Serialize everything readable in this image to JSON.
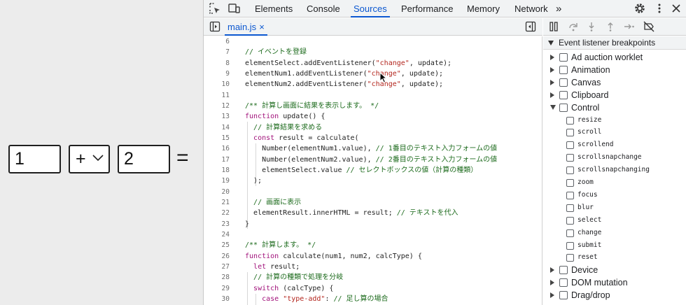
{
  "calculator": {
    "num1": "1",
    "operator": "+",
    "num2": "2",
    "equals": "="
  },
  "devtools": {
    "tabs": [
      "Elements",
      "Console",
      "Sources",
      "Performance",
      "Memory",
      "Network"
    ],
    "active_tab": "Sources",
    "more_tabs": "»",
    "file_tab": "main.js",
    "file_close": "×"
  },
  "code_lines": [
    {
      "n": "6",
      "html": ""
    },
    {
      "n": "7",
      "html": "<span class='c-comment'>// イベントを登録</span>"
    },
    {
      "n": "8",
      "html": "elementSelect.addEventListener(<span class='c-str'>\"change\"</span>, update);"
    },
    {
      "n": "9",
      "html": "elementNum1.addEventListener(<span class='c-str'>\"change\"</span>, update);"
    },
    {
      "n": "10",
      "html": "elementNum2.addEventListener(<span class='c-str'>\"change\"</span>, update);"
    },
    {
      "n": "11",
      "html": ""
    },
    {
      "n": "12",
      "html": "<span class='c-comment'>/** 計算し画面に結果を表示します。 */</span>"
    },
    {
      "n": "13",
      "html": "<span class='c-kw'>function</span> update() {"
    },
    {
      "n": "14",
      "html": "  <span class='c-comment'>// 計算結果を求める</span>"
    },
    {
      "n": "15",
      "html": "  <span class='c-kw'>const</span> result = calculate("
    },
    {
      "n": "16",
      "html": "    Number(elementNum1.value), <span class='c-comment'>// 1番目のテキスト入力フォームの値</span>"
    },
    {
      "n": "17",
      "html": "    Number(elementNum2.value), <span class='c-comment'>// 2番目のテキスト入力フォームの値</span>"
    },
    {
      "n": "18",
      "html": "    elementSelect.value <span class='c-comment'>// セレクトボックスの値（計算の種類）</span>"
    },
    {
      "n": "19",
      "html": "  );"
    },
    {
      "n": "20",
      "html": ""
    },
    {
      "n": "21",
      "html": "  <span class='c-comment'>// 画面に表示</span>"
    },
    {
      "n": "22",
      "html": "  elementResult.innerHTML = result; <span class='c-comment'>// テキストを代入</span>"
    },
    {
      "n": "23",
      "html": "}"
    },
    {
      "n": "24",
      "html": ""
    },
    {
      "n": "25",
      "html": "<span class='c-comment'>/** 計算します。 */</span>"
    },
    {
      "n": "26",
      "html": "<span class='c-kw'>function</span> calculate(num1, num2, calcType) {"
    },
    {
      "n": "27",
      "html": "  <span class='c-kw'>let</span> result;"
    },
    {
      "n": "28",
      "html": "  <span class='c-comment'>// 計算の種類で処理を分岐</span>"
    },
    {
      "n": "29",
      "html": "  <span class='c-kw'>switch</span> (calcType) {"
    },
    {
      "n": "30",
      "html": "    <span class='c-kw'>case</span> <span class='c-str'>\"type-add\"</span>: <span class='c-comment'>// 足し算の場合</span>"
    }
  ],
  "breakpoints": {
    "header": "Event listener breakpoints",
    "categories_before": [
      "Ad auction worklet",
      "Animation",
      "Canvas",
      "Clipboard"
    ],
    "expanded_category": "Control",
    "control_events": [
      "resize",
      "scroll",
      "scrollend",
      "scrollsnapchange",
      "scrollsnapchanging",
      "zoom",
      "focus",
      "blur",
      "select",
      "change",
      "submit",
      "reset"
    ],
    "categories_after": [
      "Device",
      "DOM mutation",
      "Drag/drop"
    ]
  }
}
